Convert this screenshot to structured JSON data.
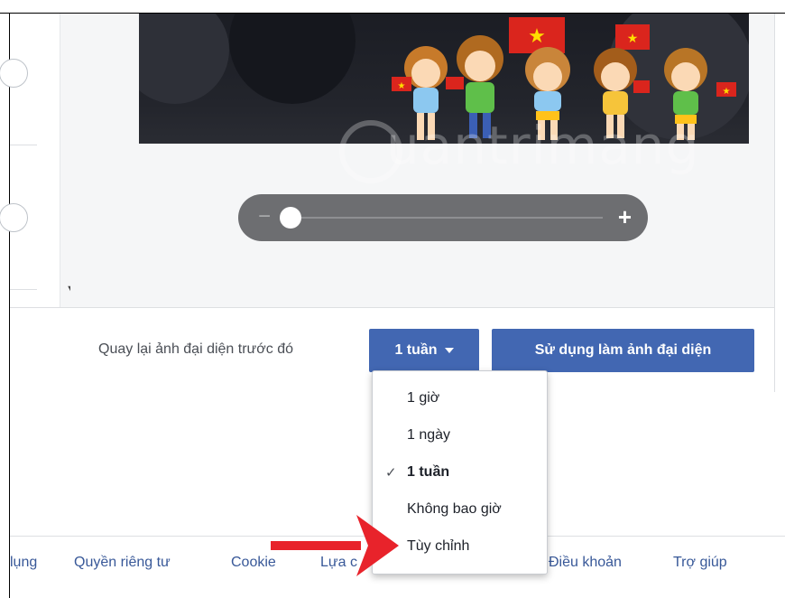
{
  "zoom_slider": {
    "minus_symbol": "−",
    "plus_symbol": "+",
    "level": 0.03
  },
  "watermark": {
    "text": "uantrimang"
  },
  "dialog_footer": {
    "revert_text": "Quay lại ảnh đại diện trước đó",
    "duration_button_label": "1 tuần",
    "use_button_label": "Sử dụng làm ảnh đại diện"
  },
  "dropdown": {
    "items": [
      {
        "label": "1 giờ",
        "selected": false
      },
      {
        "label": "1 ngày",
        "selected": false
      },
      {
        "label": "1 tuần",
        "selected": true
      },
      {
        "label": "Không bao giờ",
        "selected": false
      },
      {
        "label": "Tùy chỉnh",
        "selected": false
      }
    ],
    "check_symbol": "✓"
  },
  "footer": {
    "links": [
      "lụng",
      "Quyền riêng tư",
      "Cookie",
      "Lựa c",
      "Điều khoản",
      "Trợ giúp"
    ]
  },
  "colors": {
    "primary_button": "#4267b2",
    "link": "#385898",
    "arrow": "#e8232b",
    "slider_background": "#6d6e71"
  },
  "icons": [
    "chevron-down-icon",
    "check-icon",
    "red-arrow-icon",
    "flag-icon"
  ]
}
